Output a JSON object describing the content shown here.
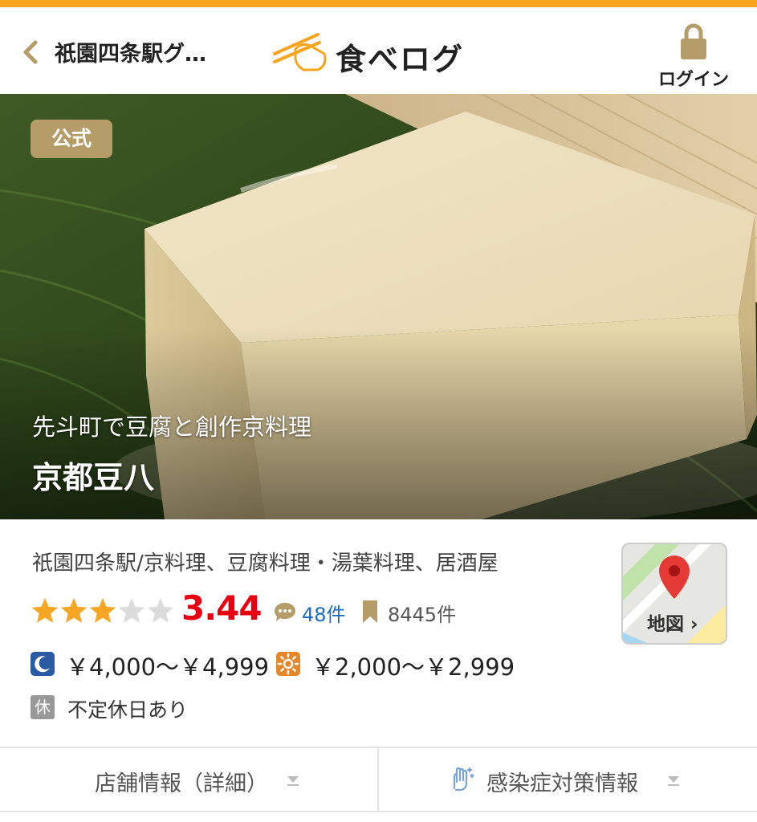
{
  "header": {
    "breadcrumb": "祇園四条駅グ…",
    "logo_text": "食べログ",
    "login_label": "ログイン"
  },
  "hero": {
    "badge": "公式",
    "tagline": "先斗町で豆腐と創作京料理",
    "shop_name": "京都豆八"
  },
  "info": {
    "category": "祇園四条駅/京料理、豆腐料理・湯葉料理、居酒屋",
    "rating": "3.44",
    "rating_value": 3.44,
    "rating_max": 5,
    "review_count": "48件",
    "save_count": "8445件",
    "dinner_price": "￥4,000～￥4,999",
    "lunch_price": "￥2,000～￥2,999",
    "holiday_icon": "休",
    "holiday_text": "不定休日あり",
    "map_label": "地図"
  },
  "tabs": {
    "shop_info": "店舗情報（詳細）",
    "covid_info": "感染症対策情報"
  },
  "colors": {
    "accent": "#f7a51e",
    "star": "#f5a623",
    "rating": "#e60012",
    "link": "#1a6bc4",
    "badge": "#b59d69"
  },
  "icons": {
    "back": "chevron-left-icon",
    "login": "lock-icon",
    "review": "comment-icon",
    "save": "bookmark-icon",
    "dinner": "moon-icon",
    "lunch": "sun-icon",
    "map_pin": "map-pin-icon",
    "covid": "hands-sparkle-icon"
  }
}
